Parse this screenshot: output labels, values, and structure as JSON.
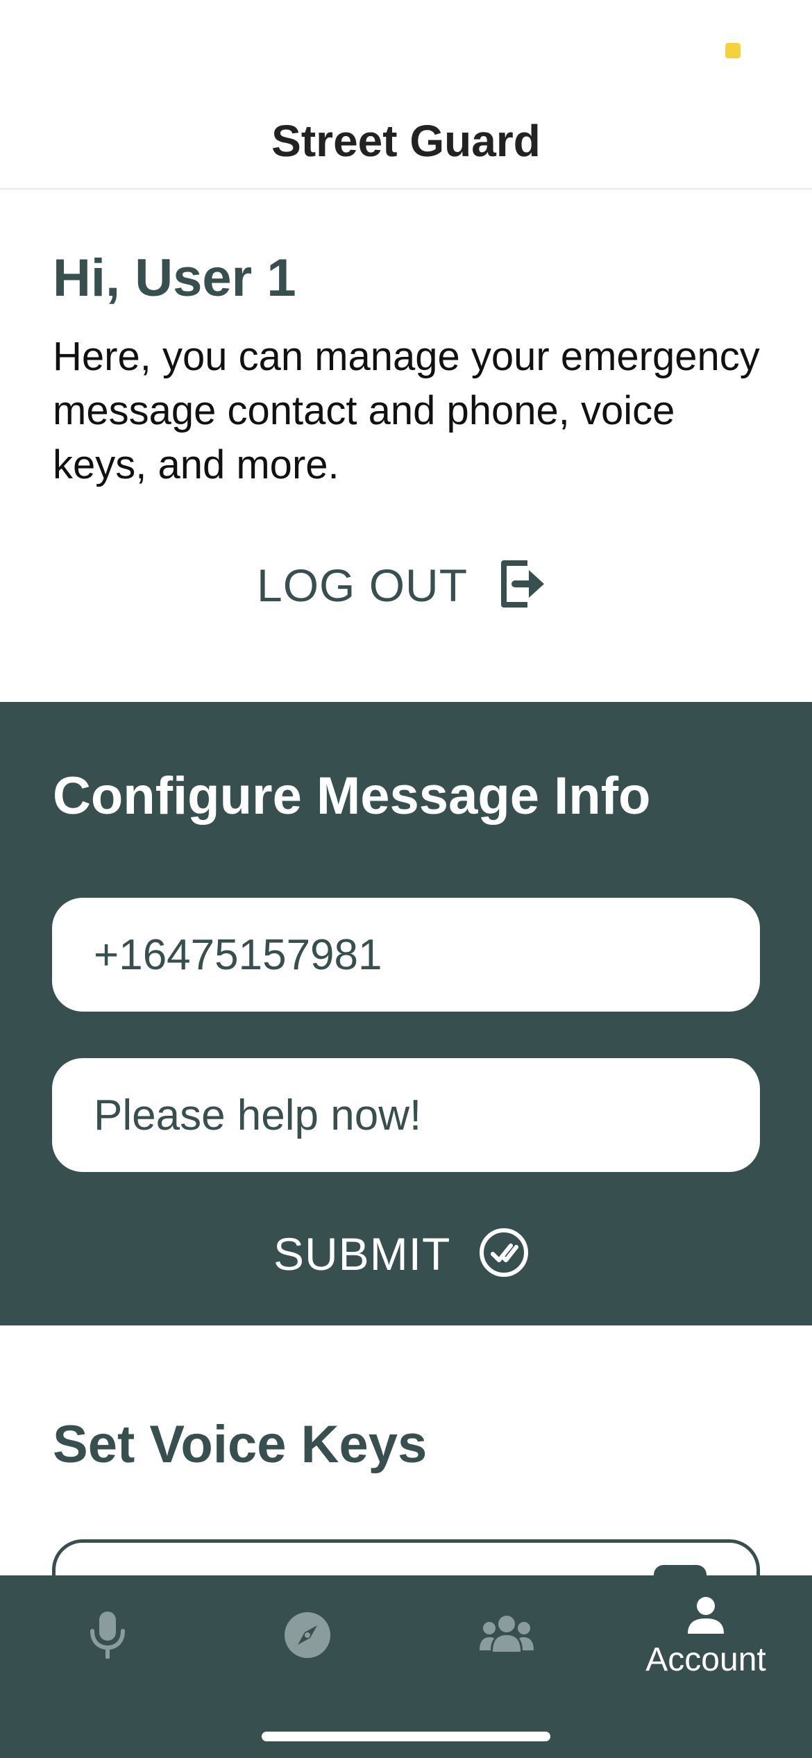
{
  "app": {
    "title": "Street Guard"
  },
  "intro": {
    "greeting": "Hi, User 1",
    "description": "Here, you can manage your emergency message contact and phone, voice keys, and more.",
    "logout_label": "LOG OUT"
  },
  "config": {
    "title": "Configure Message Info",
    "phone_value": "+16475157981",
    "message_value": "Please help now!",
    "submit_label": "SUBMIT"
  },
  "voice_keys": {
    "title": "Set Voice Keys"
  },
  "tabs": [
    {
      "icon": "microphone-icon",
      "label": ""
    },
    {
      "icon": "compass-icon",
      "label": ""
    },
    {
      "icon": "people-icon",
      "label": ""
    },
    {
      "icon": "person-icon",
      "label": "Account",
      "active": true
    }
  ],
  "colors": {
    "primary": "#384f4f",
    "background": "#ffffff",
    "status_indicator": "#f5d23c",
    "inactive_tab_icon": "#8a9c9c"
  }
}
